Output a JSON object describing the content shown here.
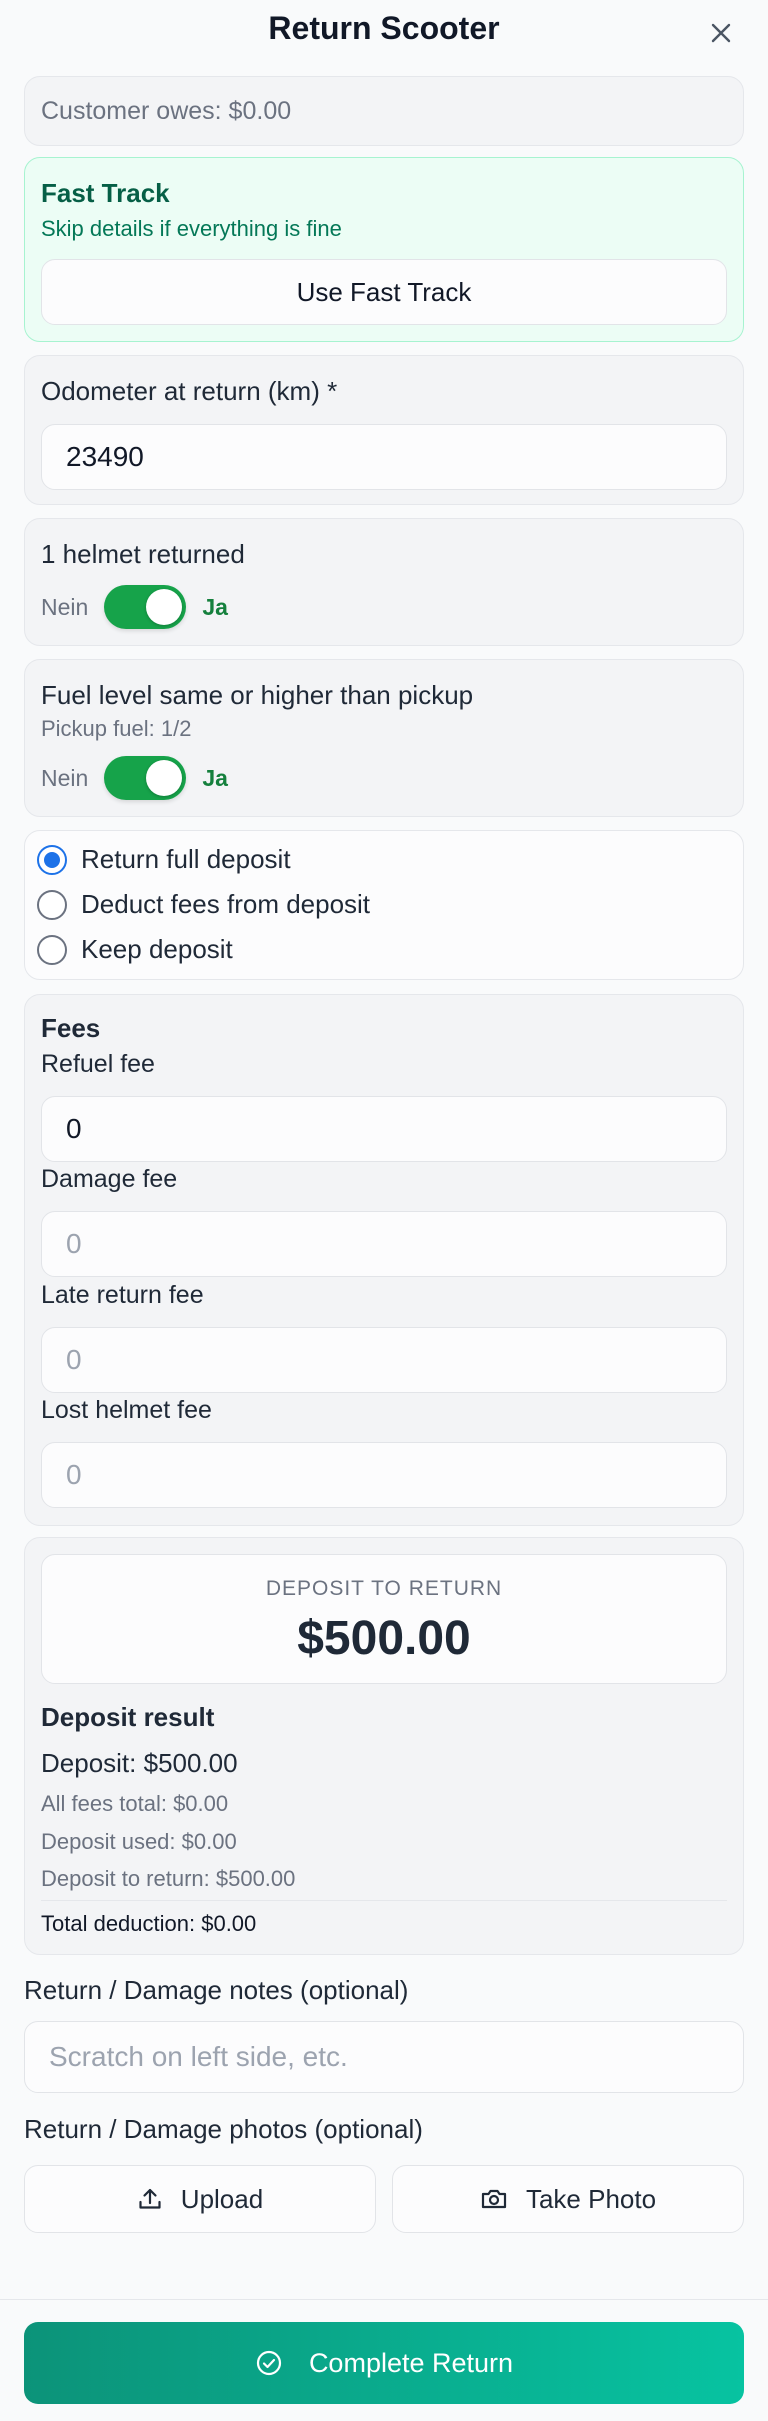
{
  "header": {
    "title": "Return Scooter",
    "close_icon": "close-icon"
  },
  "owes": {
    "text": "Customer owes: $0.00"
  },
  "fast_track": {
    "title": "Fast Track",
    "subtitle": "Skip details if everything is fine",
    "button_label": "Use Fast Track"
  },
  "odometer": {
    "label": "Odometer at return (km) *",
    "value": "23490"
  },
  "helmet": {
    "label": "1 helmet returned",
    "off_label": "Nein",
    "on_label": "Ja",
    "checked": true
  },
  "fuel": {
    "label": "Fuel level same or higher than pickup",
    "pickup_text": "Pickup fuel: 1/2",
    "off_label": "Nein",
    "on_label": "Ja",
    "checked": true
  },
  "deposit_options": [
    {
      "label": "Return full deposit",
      "checked": true
    },
    {
      "label": "Deduct fees from deposit",
      "checked": false
    },
    {
      "label": "Keep deposit",
      "checked": false
    }
  ],
  "fees": {
    "title": "Fees",
    "items": [
      {
        "label": "Refuel fee",
        "value": "0",
        "placeholder": ""
      },
      {
        "label": "Damage fee",
        "value": "",
        "placeholder": "0"
      },
      {
        "label": "Late return fee",
        "value": "",
        "placeholder": "0"
      },
      {
        "label": "Lost helmet fee",
        "value": "",
        "placeholder": "0"
      }
    ]
  },
  "deposit": {
    "caption": "DEPOSIT TO RETURN",
    "amount": "$500.00",
    "result_title": "Deposit result",
    "deposit_line": "Deposit: $500.00",
    "fees_total": "All fees total: $0.00",
    "deposit_used": "Deposit used: $0.00",
    "deposit_return": "Deposit to return: $500.00",
    "total_deduction": "Total deduction: $0.00"
  },
  "notes": {
    "label": "Return / Damage notes (optional)",
    "placeholder": "Scratch on left side, etc."
  },
  "photos": {
    "label": "Return / Damage photos (optional)",
    "upload_label": "Upload",
    "take_photo_label": "Take Photo"
  },
  "footer": {
    "complete_label": "Complete Return"
  },
  "colors": {
    "accent_green": "#16a34a",
    "radio_blue": "#1d72e8",
    "cta_start": "#0c9379",
    "cta_end": "#07c3a1"
  }
}
